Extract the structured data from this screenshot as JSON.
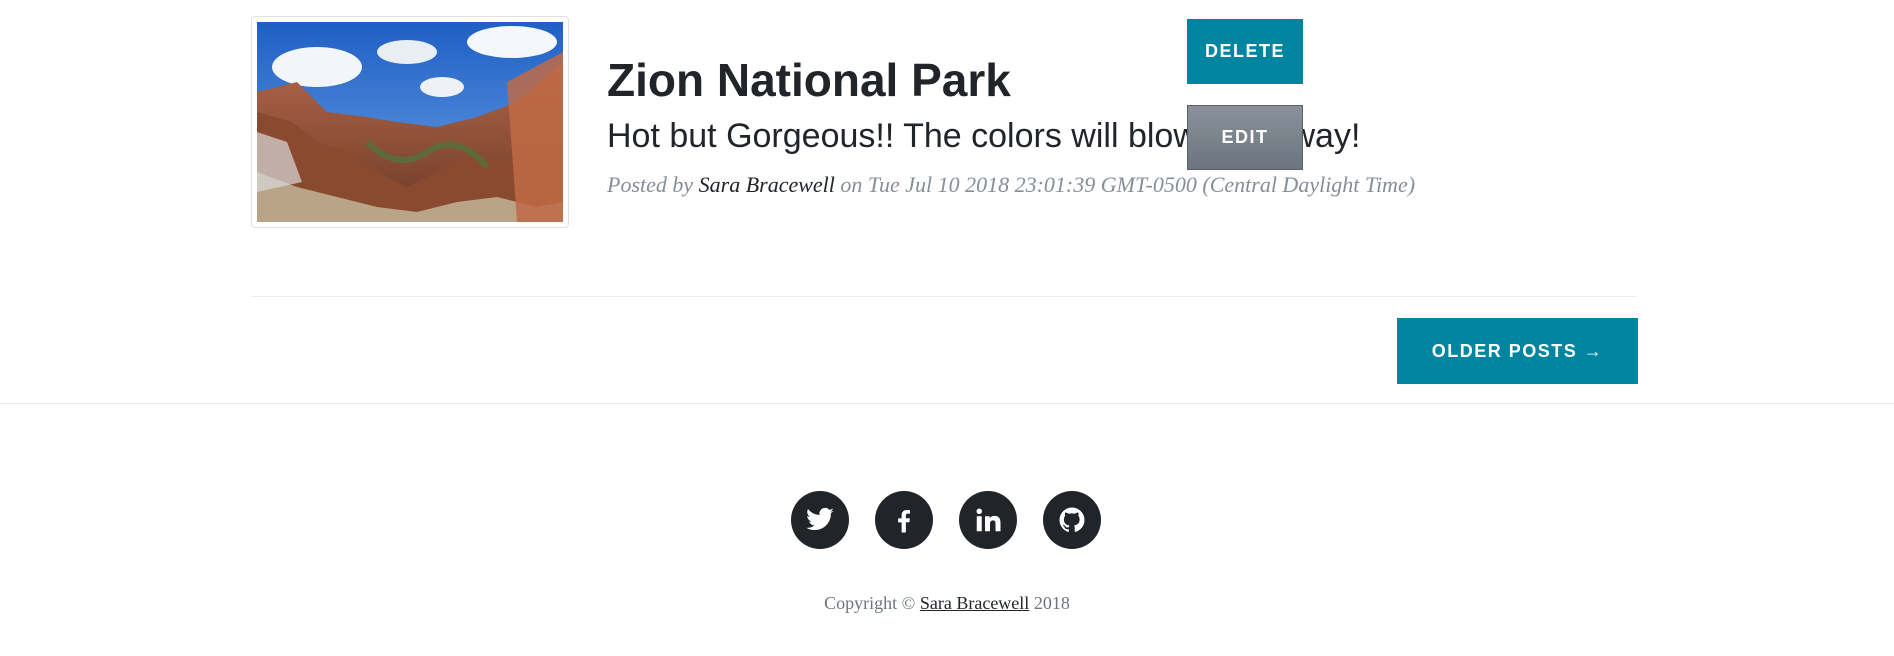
{
  "post": {
    "title": "Zion National Park",
    "subtitle": "Hot but Gorgeous!! The colors will blow you away!",
    "meta_prefix": "Posted by ",
    "author": "Sara Bracewell",
    "meta_suffix": " on Tue Jul 10 2018 23:01:39 GMT-0500 (Central Daylight Time)",
    "image_icon": "landscape-photo"
  },
  "actions": {
    "delete_label": "DELETE",
    "edit_label": "EDIT"
  },
  "pager": {
    "older_label": "OLDER POSTS →"
  },
  "footer": {
    "social": [
      {
        "name": "twitter-icon"
      },
      {
        "name": "facebook-icon"
      },
      {
        "name": "linkedin-icon"
      },
      {
        "name": "github-icon"
      }
    ],
    "copyright_prefix": "Copyright © ",
    "copyright_name": "Sara Bracewell",
    "copyright_year": " 2018"
  },
  "colors": {
    "primary": "#0085a1",
    "secondary": "#6c757d",
    "dark": "#212529",
    "muted": "#868e96"
  }
}
